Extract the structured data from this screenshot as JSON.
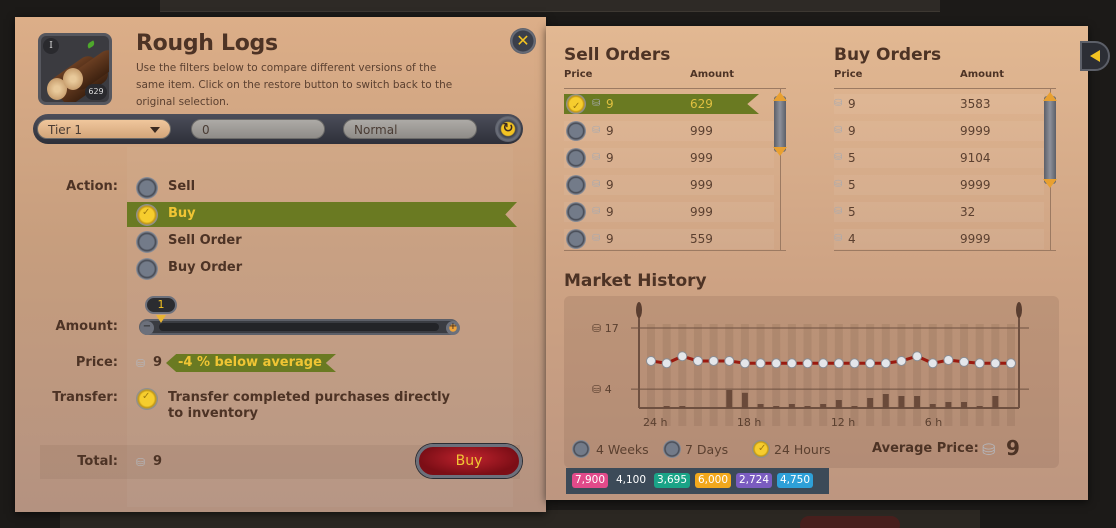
{
  "item": {
    "name": "Rough Logs",
    "tier_badge": "I",
    "quantity_badge": "629",
    "description": "Use the filters below to compare different versions of the same item. Click on the restore button to switch back to the original selection."
  },
  "filters": {
    "tier": "Tier 1",
    "enchantment": "0",
    "quality": "Normal"
  },
  "labels": {
    "action": "Action:",
    "amount": "Amount:",
    "price": "Price:",
    "transfer": "Transfer:",
    "total": "Total:"
  },
  "actions": [
    {
      "label": "Sell",
      "selected": false
    },
    {
      "label": "Buy",
      "selected": true
    },
    {
      "label": "Sell Order",
      "selected": false
    },
    {
      "label": "Buy Order",
      "selected": false
    }
  ],
  "amount": {
    "value": "1"
  },
  "price": {
    "value": "9",
    "comparison": "-4 % below average"
  },
  "transfer": {
    "checked": true,
    "text": "Transfer completed purchases directly to inventory"
  },
  "total": {
    "value": "9"
  },
  "buy_button": "Buy",
  "sell_orders": {
    "title": "Sell Orders",
    "headers": {
      "price": "Price",
      "amount": "Amount"
    },
    "rows": [
      {
        "price": "9",
        "amount": "629",
        "selected": true
      },
      {
        "price": "9",
        "amount": "999",
        "selected": false
      },
      {
        "price": "9",
        "amount": "999",
        "selected": false
      },
      {
        "price": "9",
        "amount": "999",
        "selected": false
      },
      {
        "price": "9",
        "amount": "999",
        "selected": false
      },
      {
        "price": "9",
        "amount": "559",
        "selected": false
      }
    ]
  },
  "buy_orders": {
    "title": "Buy Orders",
    "headers": {
      "price": "Price",
      "amount": "Amount"
    },
    "rows": [
      {
        "price": "9",
        "amount": "3583"
      },
      {
        "price": "9",
        "amount": "9999"
      },
      {
        "price": "5",
        "amount": "9104"
      },
      {
        "price": "5",
        "amount": "9999"
      },
      {
        "price": "5",
        "amount": "32"
      },
      {
        "price": "4",
        "amount": "9999"
      }
    ]
  },
  "market_history": {
    "title": "Market History",
    "periods": [
      {
        "label": "4 Weeks",
        "selected": false
      },
      {
        "label": "7 Days",
        "selected": false
      },
      {
        "label": "24 Hours",
        "selected": true
      }
    ],
    "average_label": "Average Price:",
    "average_value": "9"
  },
  "chart_data": {
    "type": "line",
    "title": "Market History",
    "ylabel": "Silver",
    "ylim": [
      0,
      17
    ],
    "y_ticks": [
      "17",
      "4"
    ],
    "x_ticks": [
      "24 h",
      "18 h",
      "12 h",
      "6 h"
    ],
    "series": [
      {
        "name": "Price",
        "values": [
          10,
          9.5,
          11,
          10,
          10,
          10,
          9.5,
          9.5,
          9.5,
          9.5,
          9.5,
          9.5,
          9.5,
          9.5,
          9.5,
          9.5,
          10,
          11,
          9.5,
          10.2,
          9.8,
          9.5,
          9.5,
          9.5
        ]
      },
      {
        "name": "Volume",
        "values": [
          0,
          0.5,
          0.5,
          0,
          0,
          4.5,
          3.8,
          1,
          0.5,
          1,
          0.5,
          1,
          2,
          0.5,
          2.5,
          3.5,
          3,
          3,
          1,
          1.5,
          1.5,
          0.5,
          3,
          0
        ]
      }
    ]
  },
  "stats_bar": [
    {
      "value": "7,900",
      "color": "#e24a8a"
    },
    {
      "value": "4,100",
      "color": "#3c4a58"
    },
    {
      "value": "3,695",
      "color": "#1aa387"
    },
    {
      "value": "6,000",
      "color": "#f2a81c"
    },
    {
      "value": "2,724",
      "color": "#7a5cc0"
    },
    {
      "value": "4,750",
      "color": "#2ea0d8"
    }
  ]
}
